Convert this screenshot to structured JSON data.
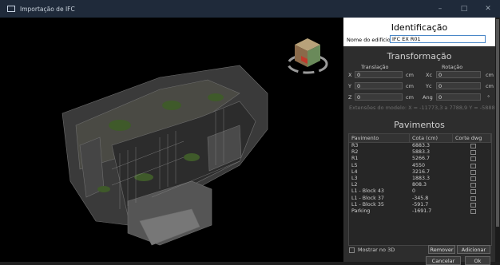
{
  "window": {
    "title": "Importação de IFC",
    "minimize": "–",
    "maximize": "□",
    "close": "✕"
  },
  "identificacao": {
    "heading": "Identificação",
    "name_label": "Nome do edifício",
    "name_value": "IFC EX R01"
  },
  "transformacao": {
    "heading": "Transformação",
    "translacao_label": "Translação",
    "rotacao_label": "Rotação",
    "rows": [
      {
        "axis": "X",
        "value": "0",
        "unit": "cm",
        "rot_label": "Xc",
        "rot_value": "0",
        "rot_unit": "cm"
      },
      {
        "axis": "Y",
        "value": "0",
        "unit": "cm",
        "rot_label": "Yc",
        "rot_value": "0",
        "rot_unit": "cm"
      },
      {
        "axis": "Z",
        "value": "0",
        "unit": "cm",
        "rot_label": "Ang",
        "rot_value": "0",
        "rot_unit": "°"
      }
    ],
    "extent": "Extensões do modelo: X = -11773,3 a 7788,9   Y = -5888,8 a 4"
  },
  "pavimentos": {
    "heading": "Pavimentos",
    "columns": [
      "Pavimento",
      "Cota (cm)",
      "Corte dwg"
    ],
    "rows": [
      {
        "name": "R3",
        "cota": "6883.3"
      },
      {
        "name": "R2",
        "cota": "5883.3"
      },
      {
        "name": "R1",
        "cota": "5266.7"
      },
      {
        "name": "L5",
        "cota": "4550"
      },
      {
        "name": "L4",
        "cota": "3216.7"
      },
      {
        "name": "L3",
        "cota": "1883.3"
      },
      {
        "name": "L2",
        "cota": "808.3"
      },
      {
        "name": "L1 - Block 43",
        "cota": "0"
      },
      {
        "name": "L1 - Block 37",
        "cota": "-345.8"
      },
      {
        "name": "L1 - Block 35",
        "cota": "-591.7"
      },
      {
        "name": "Parking",
        "cota": "-1691.7"
      }
    ]
  },
  "footer": {
    "show3d_label": "Mostrar no 3D",
    "remover": "Remover",
    "adicionar": "Adicionar",
    "cancelar": "Cancelar",
    "ok": "Ok"
  }
}
